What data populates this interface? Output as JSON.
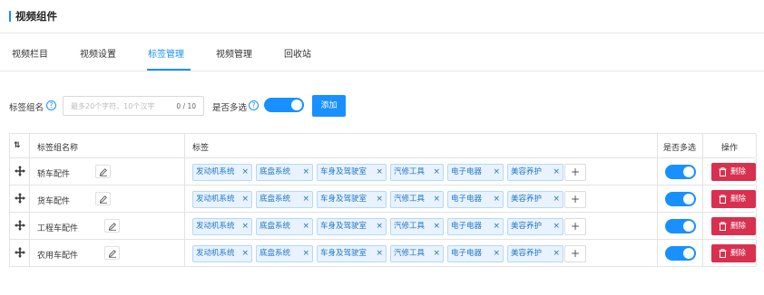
{
  "page": {
    "title": "视频组件"
  },
  "tabs": [
    "视频栏目",
    "视频设置",
    "标签管理",
    "视频管理",
    "回收站"
  ],
  "active_tab": "标签管理",
  "form": {
    "group_name_label": "标签组名",
    "group_name_placeholder": "最多20个字符，10个汉字",
    "group_name_value": "",
    "char_counter": "0 / 10",
    "multi_label": "是否多选",
    "multi_enabled": true,
    "add_button": "添加",
    "help_icon": "question-circle-icon"
  },
  "table": {
    "headers": {
      "sort": "sort-icon",
      "name": "标签组名称",
      "tags": "标签",
      "multi": "是否多选",
      "actions": "操作"
    },
    "rows": [
      {
        "name": "轿车配件",
        "tags": [
          "发动机系统",
          "底盘系统",
          "车身及驾驶室",
          "汽修工具",
          "电子电器",
          "美容养护"
        ],
        "multi": true,
        "delete_label": "删除"
      },
      {
        "name": "货车配件",
        "tags": [
          "发动机系统",
          "底盘系统",
          "车身及驾驶室",
          "汽修工具",
          "电子电器",
          "美容养护"
        ],
        "multi": true,
        "delete_label": "删除"
      },
      {
        "name": "工程车配件",
        "tags": [
          "发动机系统",
          "底盘系统",
          "车身及驾驶室",
          "汽修工具",
          "电子电器",
          "美容养护"
        ],
        "multi": true,
        "delete_label": "删除"
      },
      {
        "name": "农用车配件",
        "tags": [
          "发动机系统",
          "底盘系统",
          "车身及驾驶室",
          "汽修工具",
          "电子电器",
          "美容养护"
        ],
        "multi": true,
        "delete_label": "删除"
      }
    ],
    "tag_close_glyph": "×",
    "add_tag_glyph": "+"
  },
  "colors": {
    "primary": "#1890ff",
    "danger": "#d9304f",
    "tag_bg": "#e8f3ff",
    "tag_border": "#b3d8ff",
    "tag_text": "#1f75cb"
  }
}
